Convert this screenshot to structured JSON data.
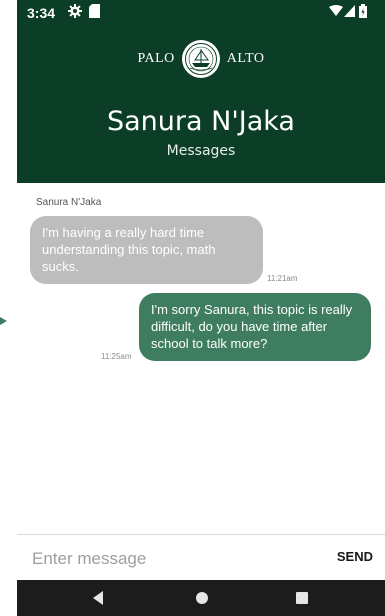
{
  "status_bar": {
    "time": "3:34",
    "icons": [
      "settings-icon",
      "sd-card-icon",
      "wifi-icon",
      "signal-icon",
      "battery-icon"
    ]
  },
  "logo": {
    "left_text": "PALO",
    "right_text": "ALTO"
  },
  "header": {
    "title": "Sanura N'Jaka",
    "subtitle": "Messages"
  },
  "conversation": {
    "sender_name": "Sanura N'Jaka",
    "messages": [
      {
        "direction": "incoming",
        "text": "I'm having a really hard time understanding this topic, math sucks.",
        "time": "11:21am"
      },
      {
        "direction": "outgoing",
        "text": "I'm sorry Sanura, this topic is really difficult, do you have time after school to talk more?",
        "time": "11:25am"
      }
    ]
  },
  "composer": {
    "placeholder": "Enter message",
    "value": "",
    "send_label": "SEND"
  },
  "nav_bar": {
    "buttons": [
      "back-icon",
      "home-icon",
      "recents-icon"
    ]
  },
  "colors": {
    "header_bg": "#0b3d27",
    "incoming_bubble": "#bdbdbd",
    "outgoing_bubble": "#3f7d61",
    "nav_bg": "#1c1c1c"
  }
}
